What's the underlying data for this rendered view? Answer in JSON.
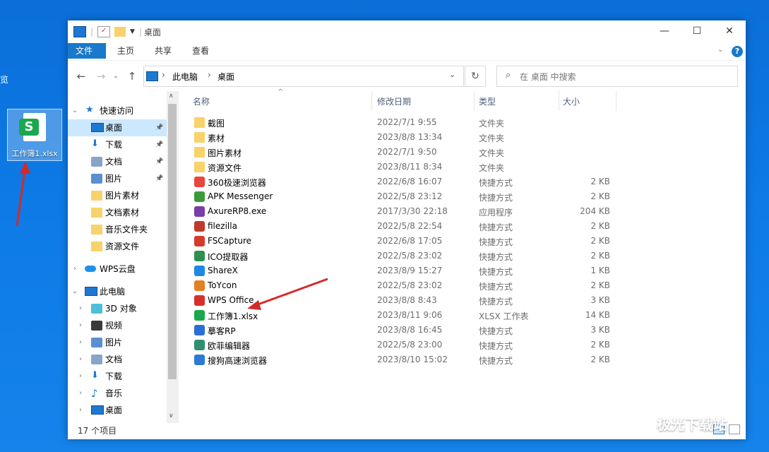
{
  "desktop": {
    "edge_text": "览",
    "icon_label": "工作簿1.xlsx",
    "icon_glyph": "S",
    "annotation_color": "#d42a2a"
  },
  "window": {
    "title": "桌面",
    "ribbon_tabs": [
      "文件",
      "主页",
      "共享",
      "查看"
    ],
    "help": "?",
    "controls": [
      "—",
      "☐",
      "✕"
    ],
    "breadcrumb": [
      "此电脑",
      "桌面"
    ],
    "search_placeholder": "在 桌面 中搜索",
    "status": "17 个项目"
  },
  "nav": {
    "quick_access": "快速访问",
    "quick_items": [
      {
        "label": "桌面",
        "icon": "desktop-icon",
        "pinned": true,
        "selected": true
      },
      {
        "label": "下载",
        "icon": "download-icon",
        "pinned": true
      },
      {
        "label": "文档",
        "icon": "document-icon",
        "pinned": true
      },
      {
        "label": "图片",
        "icon": "picture-icon",
        "pinned": true
      },
      {
        "label": "图片素材",
        "icon": "folder-icon"
      },
      {
        "label": "文档素材",
        "icon": "folder-icon"
      },
      {
        "label": "音乐文件夹",
        "icon": "folder-icon"
      },
      {
        "label": "资源文件",
        "icon": "folder-icon"
      }
    ],
    "wps_cloud": "WPS云盘",
    "this_pc": "此电脑",
    "pc_items": [
      {
        "label": "3D 对象",
        "icon": "3d-objects-icon"
      },
      {
        "label": "视频",
        "icon": "video-icon"
      },
      {
        "label": "图片",
        "icon": "picture-icon"
      },
      {
        "label": "文档",
        "icon": "document-icon"
      },
      {
        "label": "下载",
        "icon": "download-icon"
      },
      {
        "label": "音乐",
        "icon": "music-icon"
      },
      {
        "label": "桌面",
        "icon": "desktop-icon"
      }
    ]
  },
  "columns": [
    "名称",
    "修改日期",
    "类型",
    "大小"
  ],
  "files": [
    {
      "name": "截图",
      "date": "2022/7/1 9:55",
      "type": "文件夹",
      "size": "",
      "icon": "folder-icon",
      "color": "#f8d26a"
    },
    {
      "name": "素材",
      "date": "2023/8/8 13:34",
      "type": "文件夹",
      "size": "",
      "icon": "folder-icon",
      "color": "#f8d26a"
    },
    {
      "name": "图片素材",
      "date": "2022/7/1 9:50",
      "type": "文件夹",
      "size": "",
      "icon": "folder-icon",
      "color": "#f8d26a"
    },
    {
      "name": "资源文件",
      "date": "2023/8/11 8:34",
      "type": "文件夹",
      "size": "",
      "icon": "folder-icon",
      "color": "#f8d26a"
    },
    {
      "name": "360极速浏览器",
      "date": "2022/6/8 16:07",
      "type": "快捷方式",
      "size": "2 KB",
      "icon": "360-browser-icon",
      "color": "#e8453c"
    },
    {
      "name": "APK Messenger",
      "date": "2022/5/8 23:12",
      "type": "快捷方式",
      "size": "2 KB",
      "icon": "apk-messenger-icon",
      "color": "#3a9a3a"
    },
    {
      "name": "AxureRP8.exe",
      "date": "2017/3/30 22:18",
      "type": "应用程序",
      "size": "204 KB",
      "icon": "axure-icon",
      "color": "#7a3ea8"
    },
    {
      "name": "filezilla",
      "date": "2022/5/8 22:54",
      "type": "快捷方式",
      "size": "2 KB",
      "icon": "filezilla-icon",
      "color": "#c0392b"
    },
    {
      "name": "FSCapture",
      "date": "2022/6/8 17:05",
      "type": "快捷方式",
      "size": "2 KB",
      "icon": "fscapture-icon",
      "color": "#d63a2a"
    },
    {
      "name": "ICO提取器",
      "date": "2022/5/8 23:02",
      "type": "快捷方式",
      "size": "2 KB",
      "icon": "ico-extractor-icon",
      "color": "#2f8f4f"
    },
    {
      "name": "ShareX",
      "date": "2023/8/9 15:27",
      "type": "快捷方式",
      "size": "1 KB",
      "icon": "sharex-icon",
      "color": "#1e88e5"
    },
    {
      "name": "ToYcon",
      "date": "2022/5/8 23:02",
      "type": "快捷方式",
      "size": "2 KB",
      "icon": "toycon-icon",
      "color": "#e67e22"
    },
    {
      "name": "WPS Office",
      "date": "2023/8/8 8:43",
      "type": "快捷方式",
      "size": "3 KB",
      "icon": "wps-office-icon",
      "color": "#d6302b"
    },
    {
      "name": "工作簿1.xlsx",
      "date": "2023/8/11 9:06",
      "type": "XLSX 工作表",
      "size": "14 KB",
      "icon": "xlsx-icon",
      "color": "#1aa84f"
    },
    {
      "name": "摹客RP",
      "date": "2023/8/8 16:45",
      "type": "快捷方式",
      "size": "3 KB",
      "icon": "mockplus-icon",
      "color": "#2a6fd6"
    },
    {
      "name": "欧菲编辑器",
      "date": "2022/5/8 23:00",
      "type": "快捷方式",
      "size": "2 KB",
      "icon": "oufei-editor-icon",
      "color": "#2f8f6f"
    },
    {
      "name": "搜狗高速浏览器",
      "date": "2023/8/10 15:02",
      "type": "快捷方式",
      "size": "2 KB",
      "icon": "sogou-browser-icon",
      "color": "#2a7ad6"
    }
  ],
  "watermark": "极光下载站"
}
